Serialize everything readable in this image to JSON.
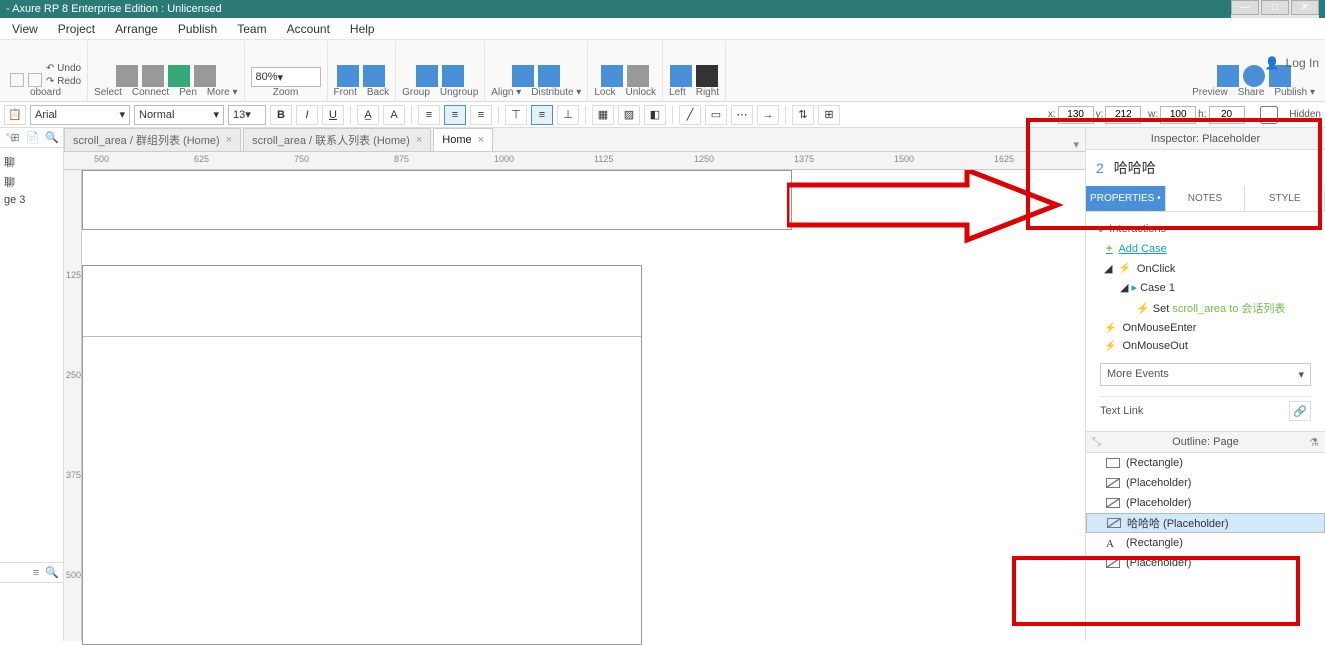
{
  "title": "- Axure RP 8 Enterprise Edition : Unlicensed",
  "menus": [
    "View",
    "Project",
    "Arrange",
    "Publish",
    "Team",
    "Account",
    "Help"
  ],
  "undo": "Undo",
  "redo": "Redo",
  "ribbon": {
    "select": "Select",
    "connect": "Connect",
    "pen": "Pen",
    "more": "More ▾",
    "zoom_val": "80%",
    "zoom": "Zoom",
    "front": "Front",
    "back": "Back",
    "group": "Group",
    "ungroup": "Ungroup",
    "align": "Align ▾",
    "distribute": "Distribute ▾",
    "lock": "Lock",
    "unlock": "Unlock",
    "left": "Left",
    "right": "Right",
    "preview": "Preview",
    "share": "Share",
    "publish": "Publish ▾"
  },
  "login": "Log In",
  "fmt": {
    "font": "Arial",
    "weight": "Normal",
    "size": "13",
    "x_lbl": "x:",
    "x": "130",
    "y_lbl": "y:",
    "y": "212",
    "w_lbl": "w:",
    "w": "100",
    "h_lbl": "h:",
    "h": "20",
    "hidden": "Hidden"
  },
  "left_tree": [
    "聊",
    "聊",
    "ge 3"
  ],
  "tabs": [
    {
      "label": "scroll_area / 群组列表 (Home)",
      "active": false
    },
    {
      "label": "scroll_area / 联系人列表 (Home)",
      "active": false
    },
    {
      "label": "Home",
      "active": true
    }
  ],
  "ruler_h": [
    "500",
    "625",
    "750",
    "875",
    "1000",
    "1125",
    "1250",
    "1375",
    "1500",
    "1625"
  ],
  "ruler_v": [
    "",
    "125",
    "250",
    "375",
    "500"
  ],
  "inspector": {
    "header": "Inspector: Placeholder",
    "count": "2",
    "name": "哈哈哈",
    "tabs": [
      "PROPERTIES",
      "NOTES",
      "STYLE"
    ],
    "section": "Interactions",
    "add": "Add Case",
    "onclick": "OnClick",
    "case1": "Case 1",
    "action_pre": "Set ",
    "action_lk": "scroll_area to 会话列表",
    "onmouseenter": "OnMouseEnter",
    "onmouseout": "OnMouseOut",
    "more": "More Events",
    "textlink": "Text Link"
  },
  "outline": {
    "header": "Outline: Page",
    "rows": [
      {
        "t": "rect",
        "label": "(Rectangle)"
      },
      {
        "t": "ph",
        "label": "(Placeholder)"
      },
      {
        "t": "ph",
        "label": "(Placeholder)"
      },
      {
        "t": "ph",
        "label": "哈哈哈 (Placeholder)",
        "sel": true
      },
      {
        "t": "txt",
        "label": "(Rectangle)"
      },
      {
        "t": "ph",
        "label": "(Placeholder)"
      }
    ]
  }
}
